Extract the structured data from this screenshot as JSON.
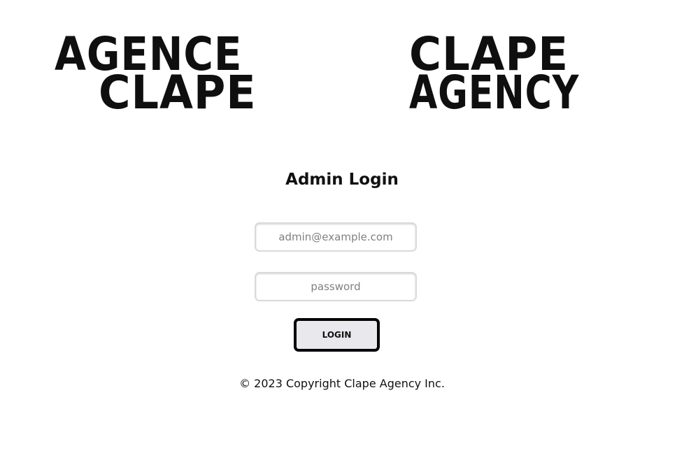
{
  "logos": {
    "left": {
      "line1": "AGENCE",
      "line2": "CLAPE"
    },
    "right": {
      "line1": "CLAPE",
      "line2": "AGENCY"
    }
  },
  "login": {
    "title": "Admin Login",
    "email_placeholder": "admin@example.com",
    "email_value": "",
    "password_placeholder": "password",
    "password_value": "",
    "button_label": "LOGIN"
  },
  "footer": {
    "copyright": "© 2023 Copyright Clape Agency Inc."
  },
  "colors": {
    "text": "#111111",
    "logo": "#0f0f0f",
    "button_bg": "#e9e8ed",
    "button_border": "#000000",
    "field_border": "#dadada",
    "placeholder": "#808080"
  }
}
